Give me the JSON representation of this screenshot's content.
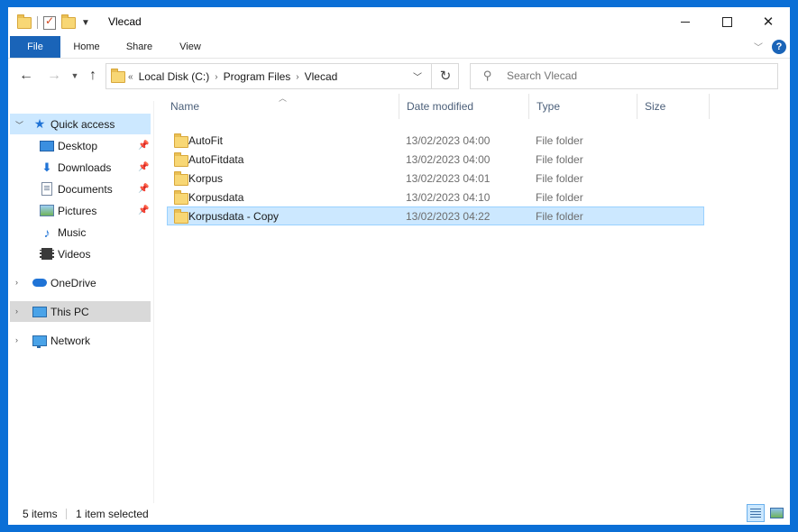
{
  "window": {
    "title": "Vlecad"
  },
  "ribbon": {
    "tabs": [
      {
        "label": "File"
      },
      {
        "label": "Home"
      },
      {
        "label": "Share"
      },
      {
        "label": "View"
      }
    ],
    "help_label": "?"
  },
  "address": {
    "overflow": "«",
    "path": [
      "Local Disk (C:)",
      "Program Files",
      "Vlecad"
    ]
  },
  "search": {
    "placeholder": "Search Vlecad"
  },
  "sidebar": {
    "items": [
      {
        "label": "Quick access",
        "icon": "star-icon",
        "selected": true
      },
      {
        "label": "Desktop",
        "icon": "desktop-icon",
        "pinned": true
      },
      {
        "label": "Downloads",
        "icon": "download-icon",
        "pinned": true
      },
      {
        "label": "Documents",
        "icon": "documents-icon",
        "pinned": true
      },
      {
        "label": "Pictures",
        "icon": "pictures-icon",
        "pinned": true
      },
      {
        "label": "Music",
        "icon": "music-icon"
      },
      {
        "label": "Videos",
        "icon": "videos-icon"
      },
      {
        "label": "OneDrive",
        "icon": "onedrive-icon"
      },
      {
        "label": "This PC",
        "icon": "this-pc-icon"
      },
      {
        "label": "Network",
        "icon": "network-icon"
      }
    ]
  },
  "filelist": {
    "columns": [
      "Name",
      "Date modified",
      "Type",
      "Size"
    ],
    "rows": [
      {
        "name": "AutoFit",
        "date": "13/02/2023 04:00",
        "type": "File folder"
      },
      {
        "name": "AutoFitdata",
        "date": "13/02/2023 04:00",
        "type": "File folder"
      },
      {
        "name": "Korpus",
        "date": "13/02/2023 04:01",
        "type": "File folder"
      },
      {
        "name": "Korpusdata",
        "date": "13/02/2023 04:10",
        "type": "File folder"
      },
      {
        "name": "Korpusdata - Copy",
        "date": "13/02/2023 04:22",
        "type": "File folder",
        "selected": true
      }
    ]
  },
  "status": {
    "count": "5 items",
    "selection": "1 item selected"
  },
  "colors": {
    "accent": "#1a64b8",
    "selection": "#cce8ff",
    "desktop": "#0b6fd6"
  }
}
